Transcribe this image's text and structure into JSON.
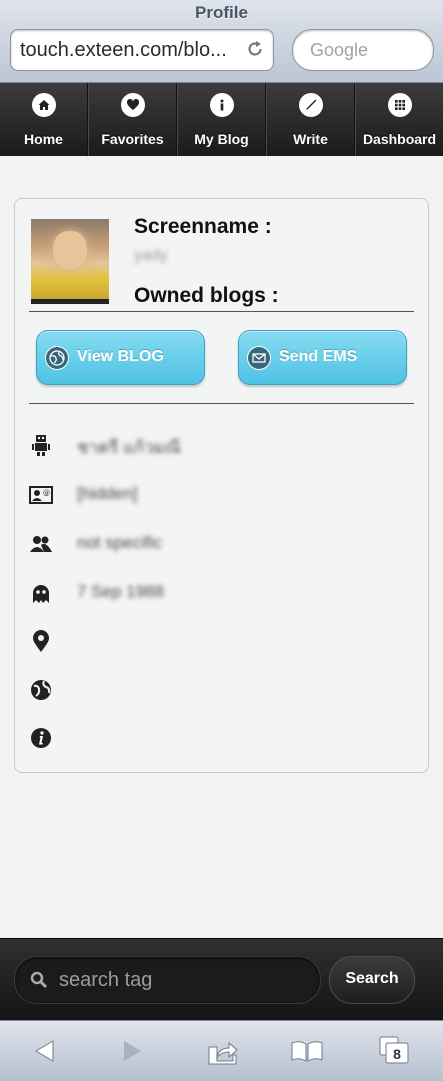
{
  "browser": {
    "title": "Profile",
    "url": "touch.exteen.com/blo...",
    "search_placeholder": "Google"
  },
  "nav": [
    {
      "label": "Home",
      "icon": "home-icon"
    },
    {
      "label": "Favorites",
      "icon": "heart-icon"
    },
    {
      "label": "My Blog",
      "icon": "info-icon"
    },
    {
      "label": "Write",
      "icon": "pen-icon"
    },
    {
      "label": "Dashboard",
      "icon": "grid-icon"
    }
  ],
  "profile": {
    "screenname_label": "Screenname :",
    "screenname_value": "yady",
    "owned_blogs_label": "Owned blogs :",
    "view_blog_label": "View BLOG",
    "send_ems_label": "Send EMS",
    "info": [
      {
        "icon": "robot-icon",
        "value": "ชาตรี แก้วมณี"
      },
      {
        "icon": "contact-card-icon",
        "value": "[hidden]"
      },
      {
        "icon": "people-icon",
        "value": "not specific"
      },
      {
        "icon": "ghost-icon",
        "value": "7 Sep 1988"
      },
      {
        "icon": "location-pin-icon",
        "value": ""
      },
      {
        "icon": "globe-icon",
        "value": ""
      },
      {
        "icon": "info-circle-icon",
        "value": ""
      }
    ]
  },
  "tag_search": {
    "placeholder": "search tag",
    "button_label": "Search"
  },
  "toolbar": {
    "tabs_count": "8"
  },
  "colors": {
    "button_accent": "#5ccaea",
    "navbar_bg": "#2a2a2a"
  }
}
